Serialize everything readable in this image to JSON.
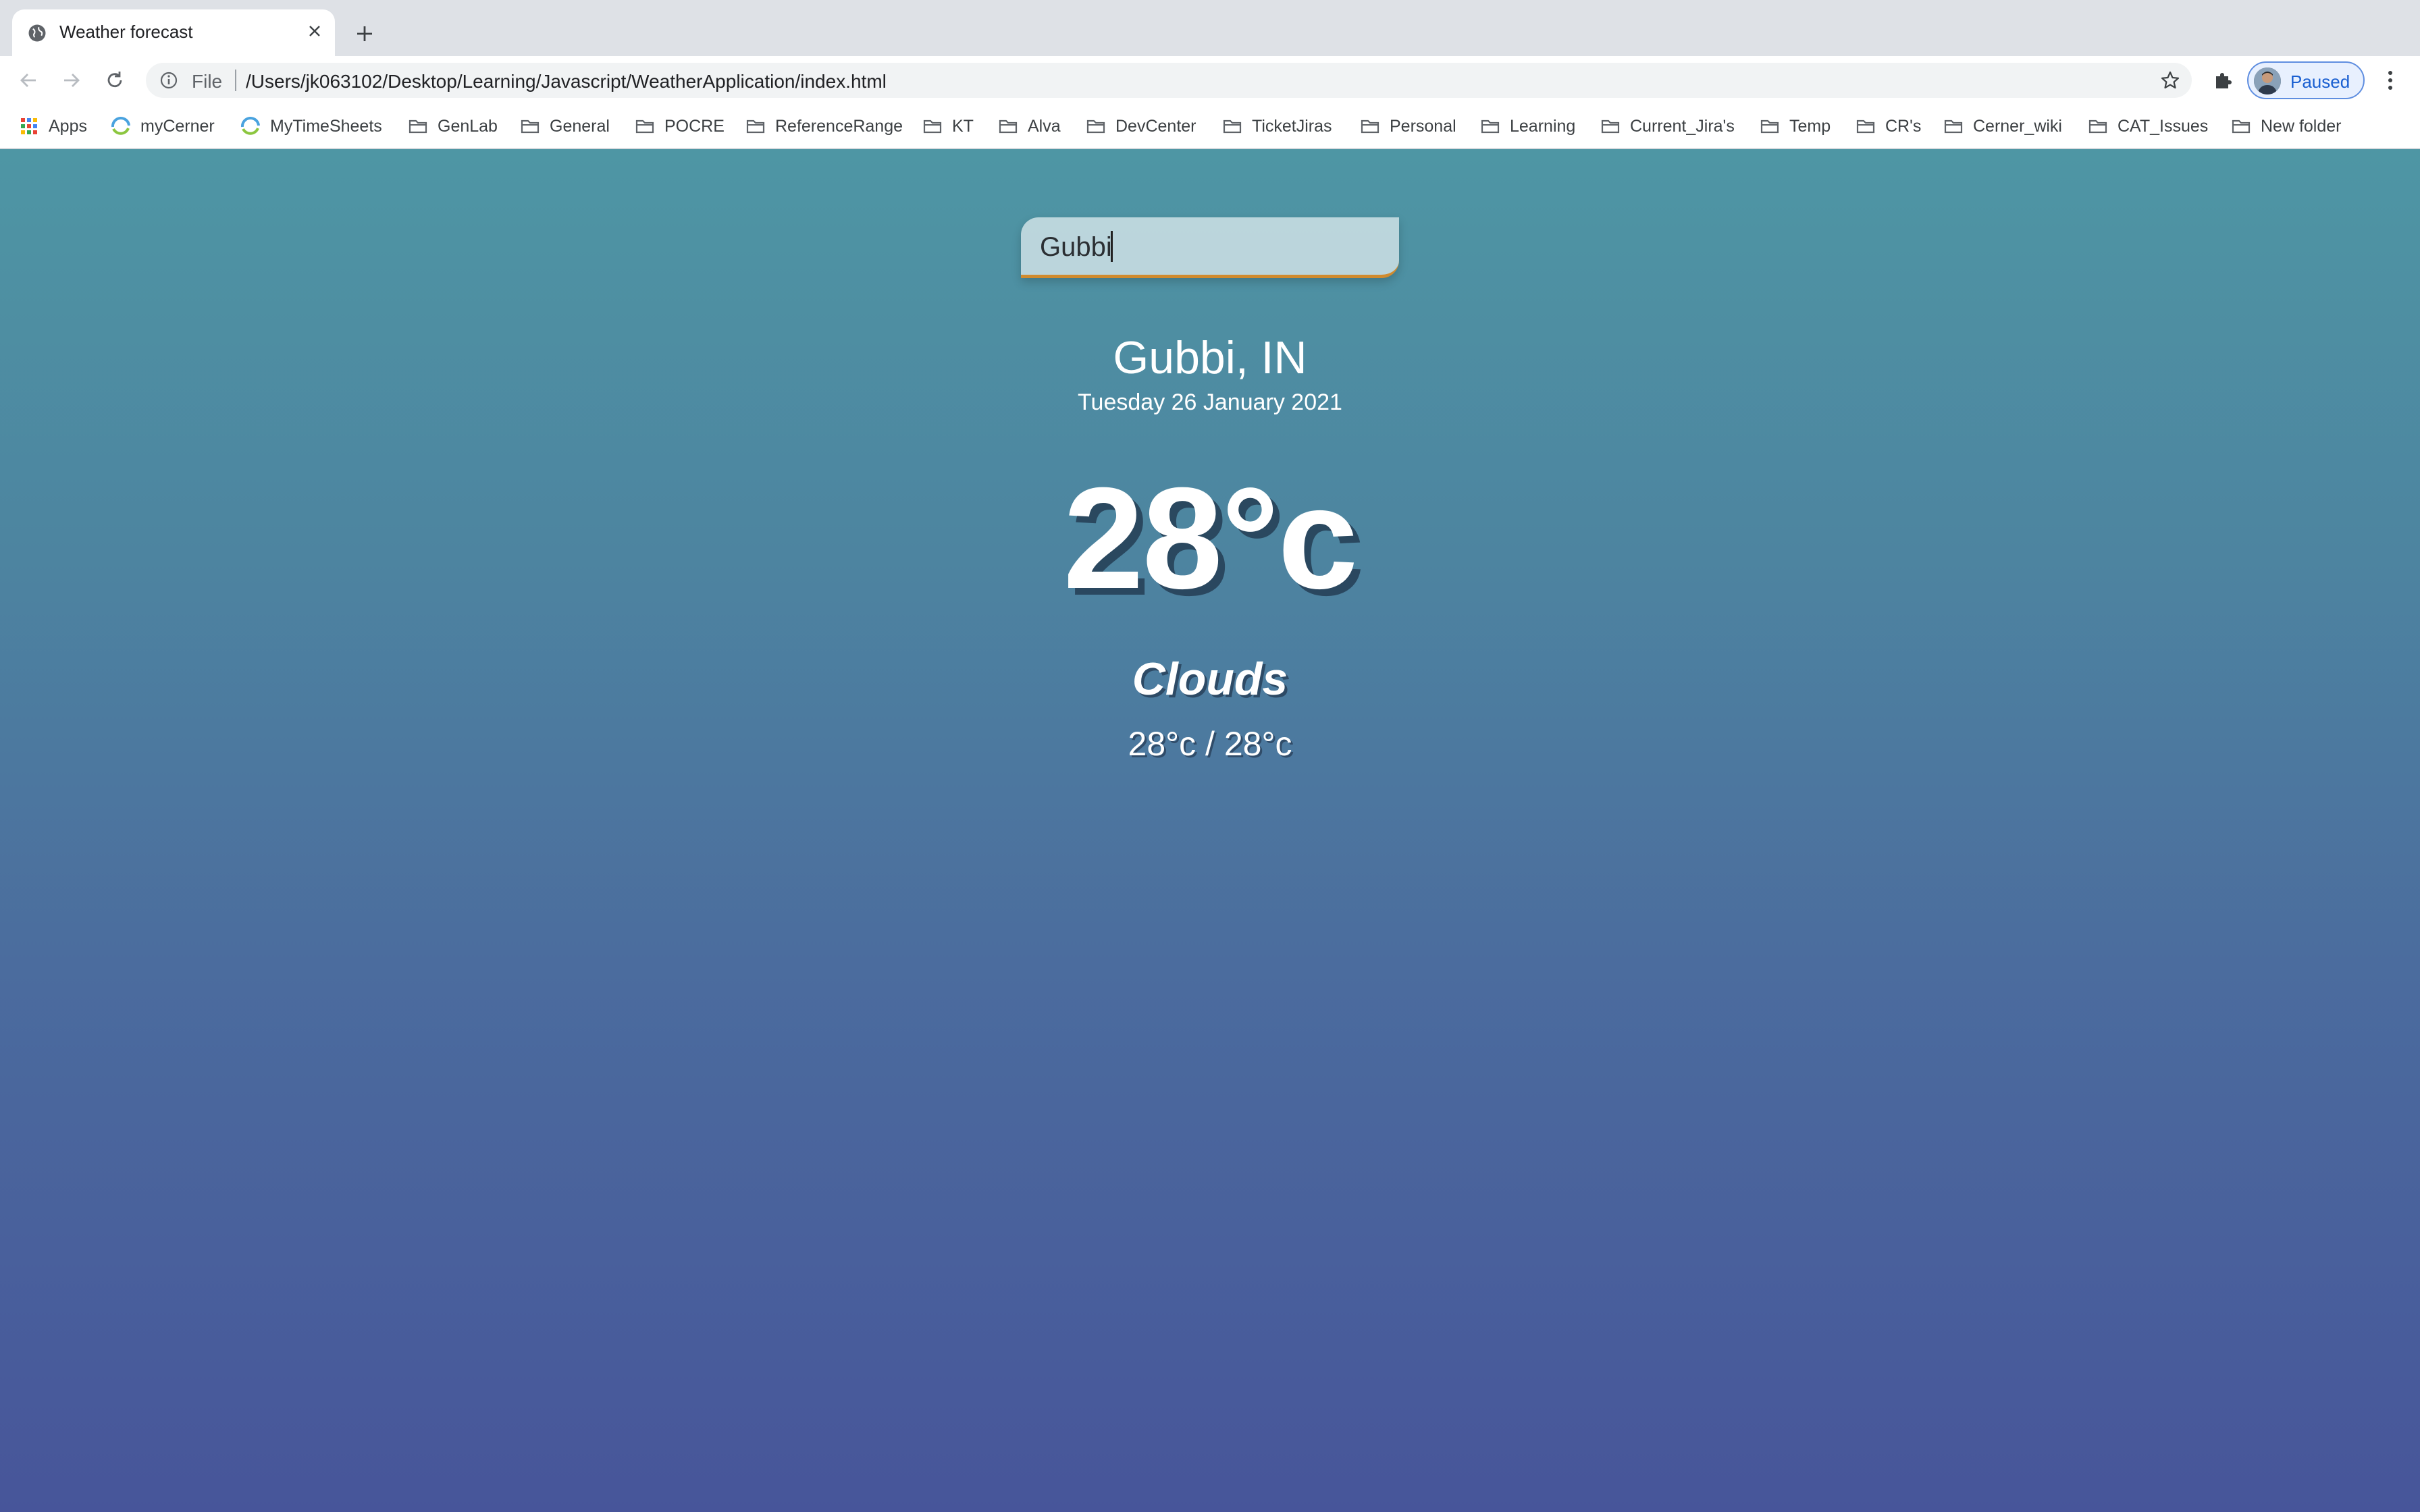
{
  "browser": {
    "tab": {
      "title": "Weather forecast"
    },
    "omnibox": {
      "scheme_label": "File",
      "url": "/Users/jk063102/Desktop/Learning/Javascript/WeatherApplication/index.html"
    },
    "profile": {
      "label": "Paused"
    },
    "bookmarks": [
      {
        "label": "Apps",
        "icon": "apps-grid-icon"
      },
      {
        "label": "myCerner",
        "icon": "site-icon"
      },
      {
        "label": "MyTimeSheets",
        "icon": "site-icon"
      },
      {
        "label": "GenLab",
        "icon": "folder-icon"
      },
      {
        "label": "General",
        "icon": "folder-icon"
      },
      {
        "label": "POCRE",
        "icon": "folder-icon"
      },
      {
        "label": "ReferenceRange",
        "icon": "folder-icon"
      },
      {
        "label": "KT",
        "icon": "folder-icon"
      },
      {
        "label": "Alva",
        "icon": "folder-icon"
      },
      {
        "label": "DevCenter",
        "icon": "folder-icon"
      },
      {
        "label": "TicketJiras",
        "icon": "folder-icon"
      },
      {
        "label": "Personal",
        "icon": "folder-icon"
      },
      {
        "label": "Learning",
        "icon": "folder-icon"
      },
      {
        "label": "Current_Jira's",
        "icon": "folder-icon"
      },
      {
        "label": "Temp",
        "icon": "folder-icon"
      },
      {
        "label": "CR's",
        "icon": "folder-icon"
      },
      {
        "label": "Cerner_wiki",
        "icon": "folder-icon"
      },
      {
        "label": "CAT_Issues",
        "icon": "folder-icon"
      },
      {
        "label": "New folder",
        "icon": "folder-icon"
      }
    ]
  },
  "app": {
    "search": {
      "value": "Gubbi"
    },
    "location": {
      "city": "Gubbi, IN",
      "date": "Tuesday 26 January 2021"
    },
    "current": {
      "temp": "28°c",
      "weather": "Clouds",
      "hi_low": "28°c / 28°c"
    }
  },
  "colors": {
    "gradient_top": "#4e96a4",
    "gradient_bottom": "#47559a",
    "search_underline": "#d08b2e",
    "profile_accent": "#1a5fd1"
  }
}
